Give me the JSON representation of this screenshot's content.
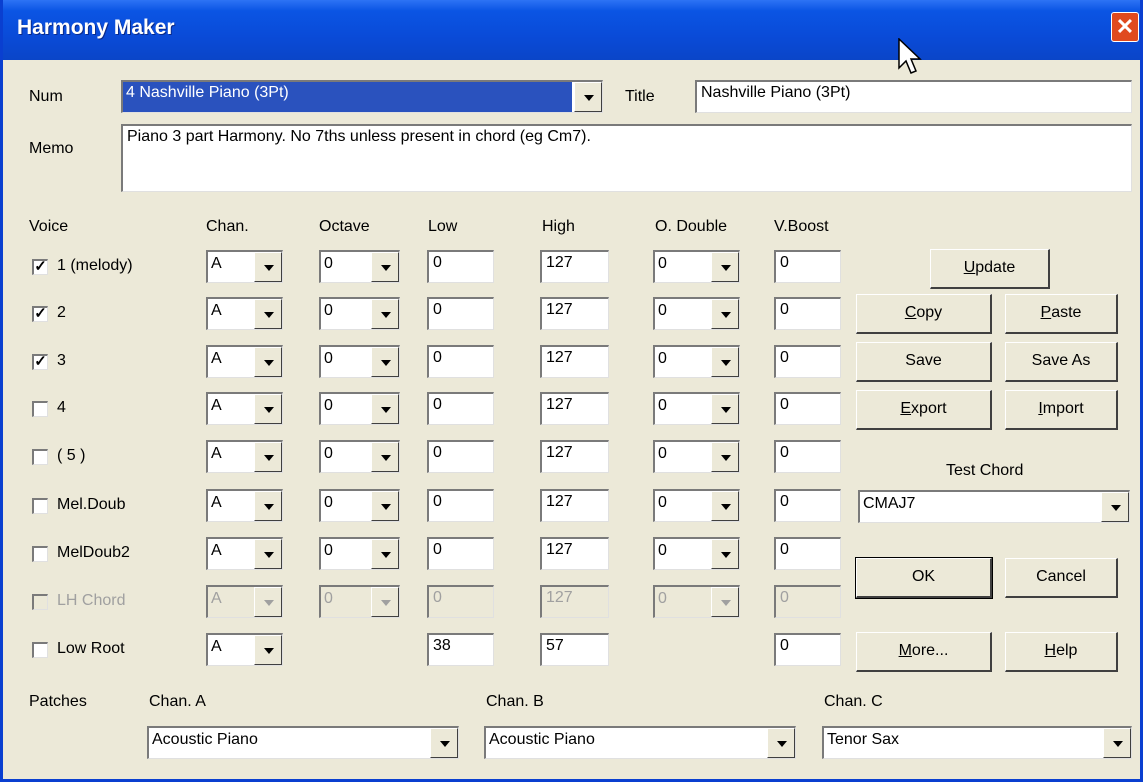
{
  "window": {
    "title": "Harmony Maker",
    "close_glyph": "✕"
  },
  "header": {
    "num_label": "Num",
    "num_value": "4 Nashville Piano (3Pt)",
    "title_label": "Title",
    "title_value": "Nashville Piano (3Pt)",
    "memo_label": "Memo",
    "memo_value": "Piano 3 part Harmony. No 7ths unless present in chord (eg Cm7)."
  },
  "columns": [
    "Voice",
    "Chan.",
    "Octave",
    "Low",
    "High",
    "O. Double",
    "V.Boost"
  ],
  "voices": [
    {
      "name": "1 (melody)",
      "checked": true,
      "chan": "A",
      "octave": "0",
      "low": "0",
      "high": "127",
      "odouble": "0",
      "vboost": "0"
    },
    {
      "name": "2",
      "checked": true,
      "chan": "A",
      "octave": "0",
      "low": "0",
      "high": "127",
      "odouble": "0",
      "vboost": "0"
    },
    {
      "name": "3",
      "checked": true,
      "chan": "A",
      "octave": "0",
      "low": "0",
      "high": "127",
      "odouble": "0",
      "vboost": "0"
    },
    {
      "name": "4",
      "checked": false,
      "chan": "A",
      "octave": "0",
      "low": "0",
      "high": "127",
      "odouble": "0",
      "vboost": "0"
    },
    {
      "name": "( 5 )",
      "checked": false,
      "chan": "A",
      "octave": "0",
      "low": "0",
      "high": "127",
      "odouble": "0",
      "vboost": "0"
    },
    {
      "name": "Mel.Doub",
      "checked": false,
      "chan": "A",
      "octave": "0",
      "low": "0",
      "high": "127",
      "odouble": "0",
      "vboost": "0"
    },
    {
      "name": "MelDoub2",
      "checked": false,
      "chan": "A",
      "octave": "0",
      "low": "0",
      "high": "127",
      "odouble": "0",
      "vboost": "0"
    },
    {
      "name": "LH Chord",
      "checked": false,
      "disabled": true,
      "chan": "A",
      "octave": "0",
      "low": "0",
      "high": "127",
      "odouble": "0",
      "vboost": "0"
    },
    {
      "name": "Low Root",
      "checked": false,
      "chan": "A",
      "low": "38",
      "high": "57",
      "vboost": "0"
    }
  ],
  "buttons": {
    "update": {
      "pre": "",
      "u": "U",
      "post": "pdate"
    },
    "copy": {
      "pre": "",
      "u": "C",
      "post": "opy"
    },
    "paste": {
      "pre": "",
      "u": "P",
      "post": "aste"
    },
    "save": {
      "pre": "Save",
      "u": "",
      "post": ""
    },
    "save_as": {
      "pre": "Save As",
      "u": "",
      "post": ""
    },
    "export": {
      "pre": "",
      "u": "E",
      "post": "xport"
    },
    "import": {
      "pre": "",
      "u": "I",
      "post": "mport"
    },
    "ok": {
      "pre": "OK",
      "u": "",
      "post": ""
    },
    "cancel": {
      "pre": "Cancel",
      "u": "",
      "post": ""
    },
    "more": {
      "pre": "",
      "u": "M",
      "post": "ore..."
    },
    "help": {
      "pre": "",
      "u": "H",
      "post": "elp"
    }
  },
  "test_chord": {
    "label": "Test Chord",
    "value": "CMAJ7"
  },
  "patches": {
    "label": "Patches",
    "chan_a_label": "Chan. A",
    "chan_a_value": "Acoustic Piano",
    "chan_b_label": "Chan. B",
    "chan_b_value": "Acoustic Piano",
    "chan_c_label": "Chan. C",
    "chan_c_value": "Tenor Sax"
  },
  "check_glyph": "✓"
}
